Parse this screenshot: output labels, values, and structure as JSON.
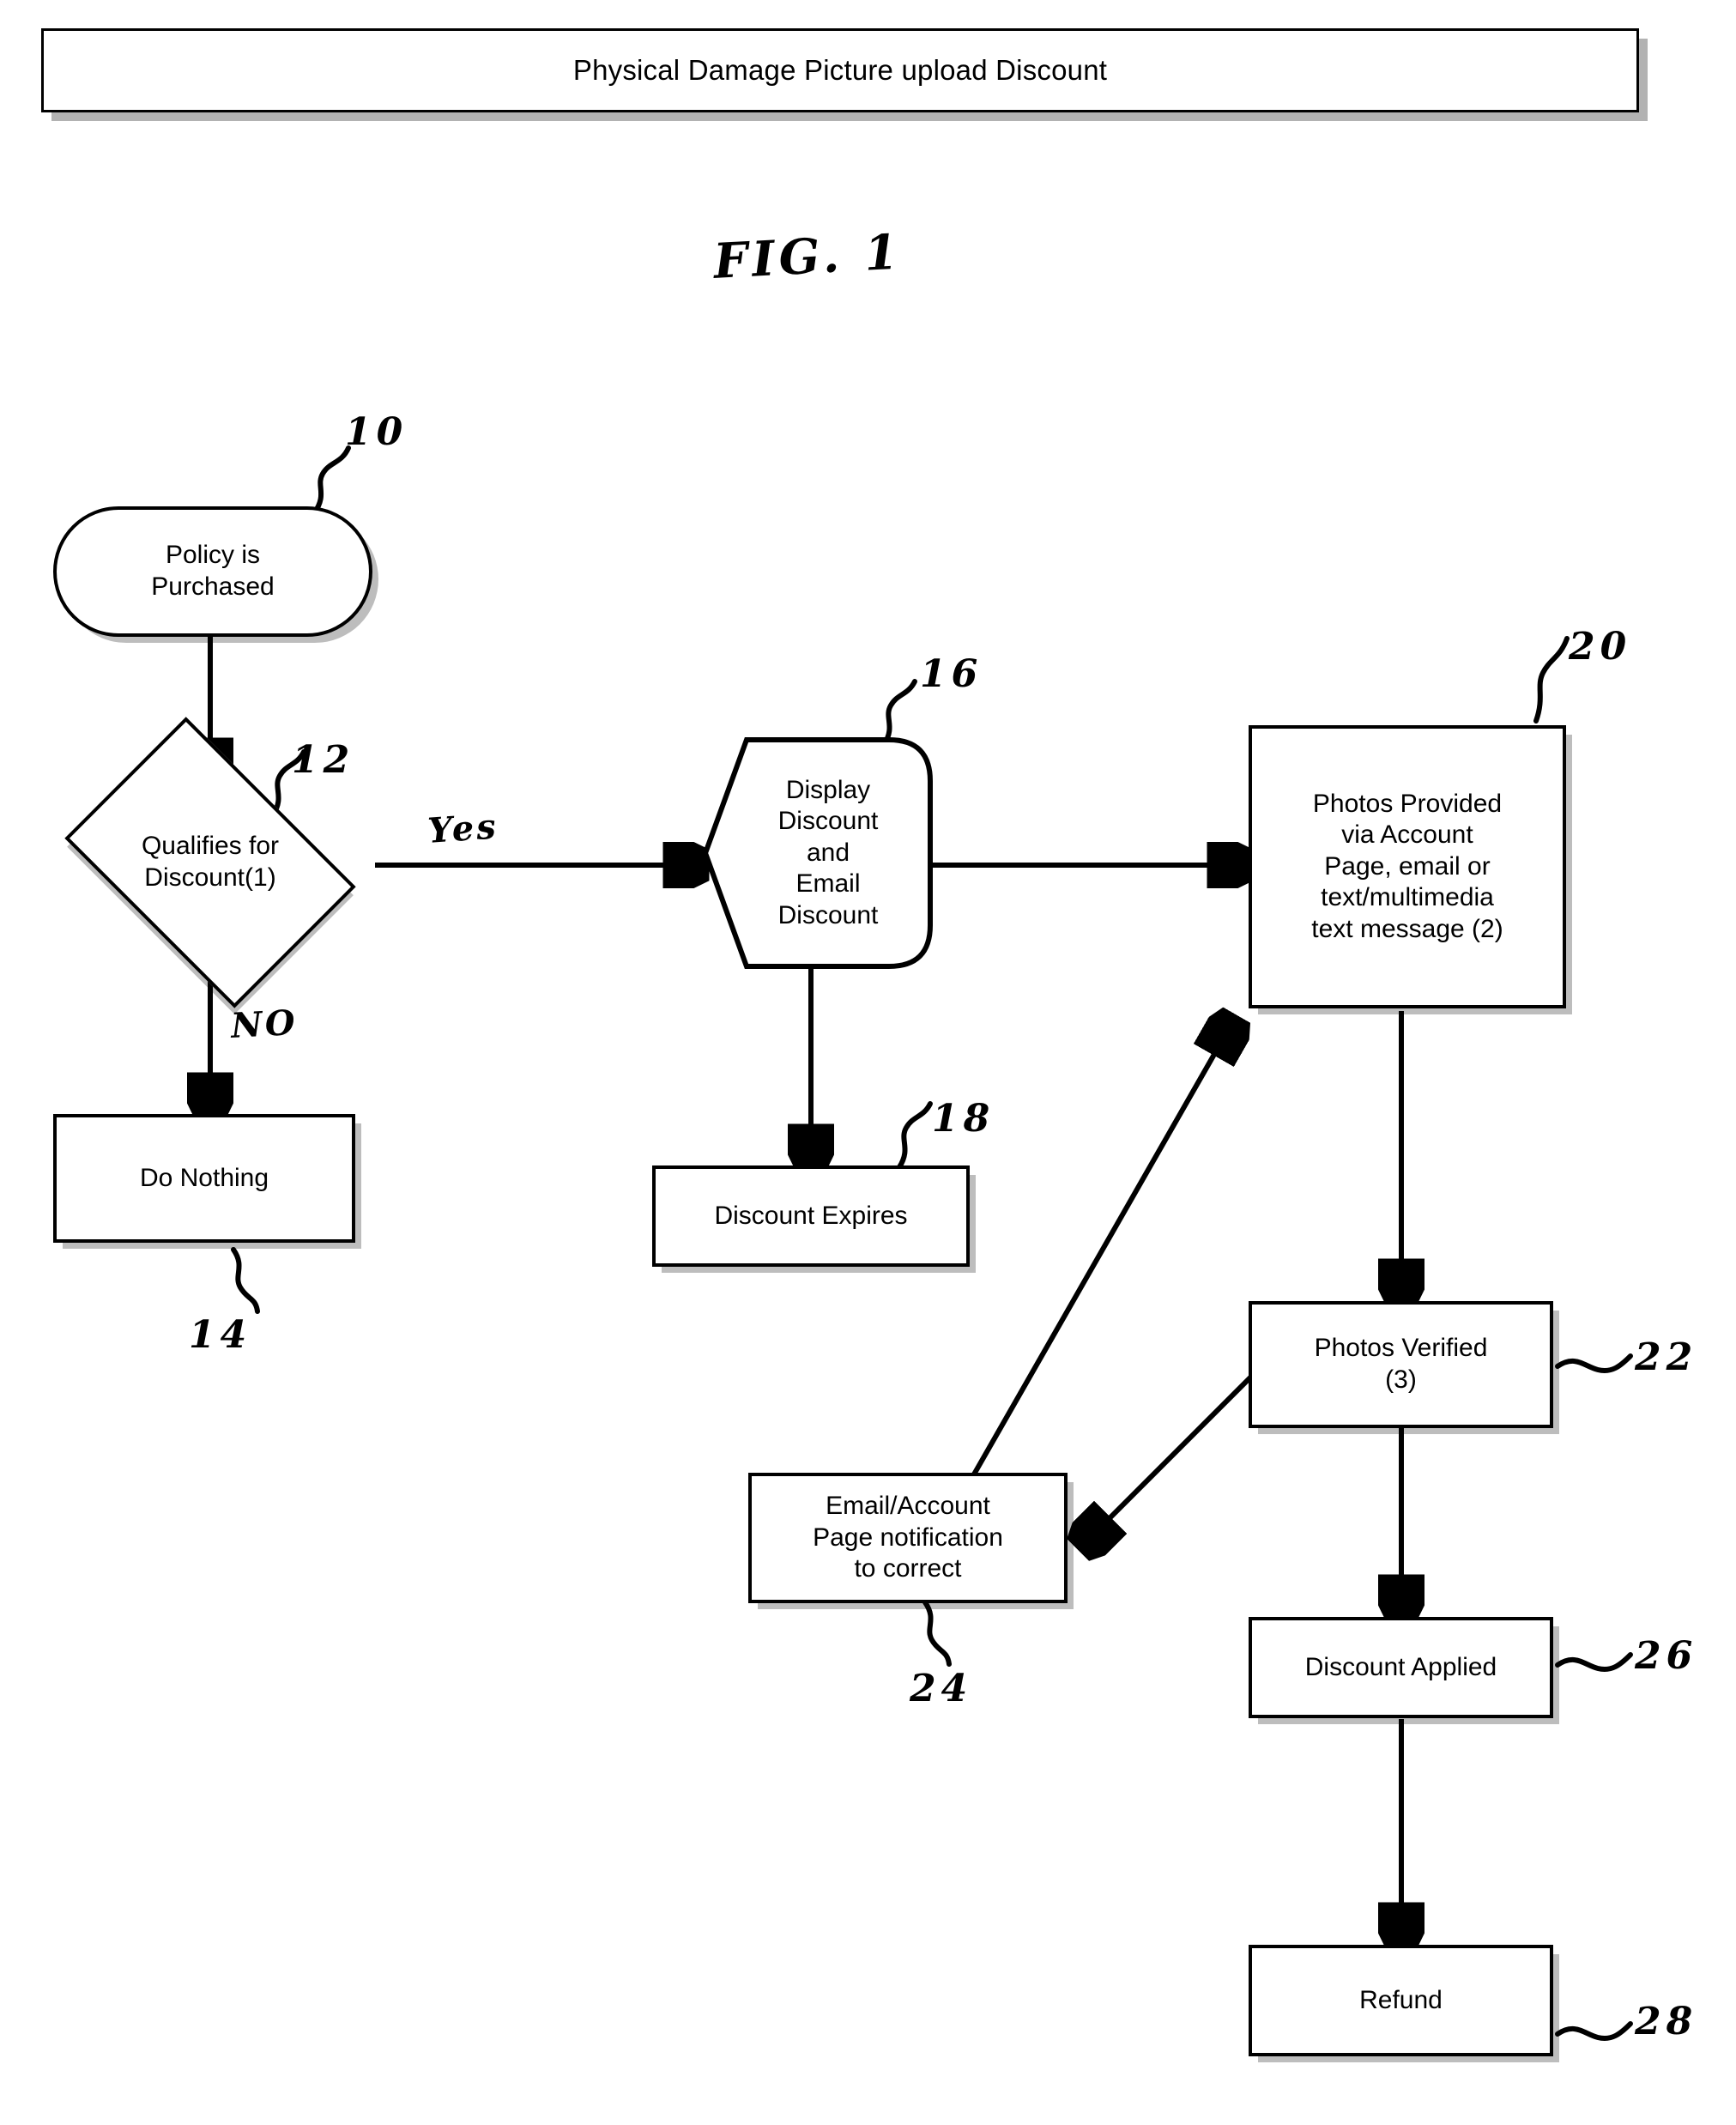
{
  "header": {
    "title": "Physical Damage Picture upload Discount"
  },
  "figure": {
    "label": "FIG. 1"
  },
  "chart_data": {
    "type": "diagram",
    "title": "Physical Damage Picture upload Discount",
    "figure_label": "FIG. 1",
    "nodes": [
      {
        "ref": "10",
        "shape": "stadium",
        "label": "Policy is\nPurchased"
      },
      {
        "ref": "12",
        "shape": "diamond",
        "label": "Qualifies for\nDiscount(1)"
      },
      {
        "ref": "14",
        "shape": "rectangle",
        "label": "Do Nothing"
      },
      {
        "ref": "16",
        "shape": "hexagon",
        "label": "Display\nDiscount\nand\nEmail\nDiscount"
      },
      {
        "ref": "18",
        "shape": "rectangle",
        "label": "Discount Expires"
      },
      {
        "ref": "20",
        "shape": "rectangle",
        "label": "Photos Provided\nvia Account\nPage, email or\ntext/multimedia\ntext message (2)"
      },
      {
        "ref": "22",
        "shape": "rectangle",
        "label": "Photos Verified\n(3)"
      },
      {
        "ref": "24",
        "shape": "rectangle",
        "label": "Email/Account\nPage notification\nto correct"
      },
      {
        "ref": "26",
        "shape": "rectangle",
        "label": "Discount Applied"
      },
      {
        "ref": "28",
        "shape": "rectangle",
        "label": "Refund"
      }
    ],
    "edges": [
      {
        "from": "10",
        "to": "12",
        "label": ""
      },
      {
        "from": "12",
        "to": "16",
        "label": "Yes"
      },
      {
        "from": "12",
        "to": "14",
        "label": "NO"
      },
      {
        "from": "16",
        "to": "20",
        "label": ""
      },
      {
        "from": "16",
        "to": "18",
        "label": ""
      },
      {
        "from": "20",
        "to": "22",
        "label": ""
      },
      {
        "from": "22",
        "to": "24",
        "label": ""
      },
      {
        "from": "24",
        "to": "20",
        "label": ""
      },
      {
        "from": "22",
        "to": "26",
        "label": ""
      },
      {
        "from": "26",
        "to": "28",
        "label": ""
      }
    ]
  },
  "nodes": {
    "policy_purchased": {
      "line1": "Policy is",
      "line2": "Purchased",
      "ref": "10"
    },
    "qualifies": {
      "line1": "Qualifies for",
      "line2": "Discount(1)",
      "ref": "12"
    },
    "do_nothing": {
      "label": "Do Nothing",
      "ref": "14"
    },
    "display_discount": {
      "line1": "Display",
      "line2": "Discount",
      "line3": "and",
      "line4": "Email",
      "line5": "Discount",
      "ref": "16"
    },
    "discount_expires": {
      "label": "Discount Expires",
      "ref": "18"
    },
    "photos_provided": {
      "line1": "Photos Provided",
      "line2": "via Account",
      "line3": "Page, email or",
      "line4": "text/multimedia",
      "line5": "text message (2)",
      "ref": "20"
    },
    "photos_verified": {
      "line1": "Photos Verified",
      "line2": "(3)",
      "ref": "22"
    },
    "email_notification": {
      "line1": "Email/Account",
      "line2": "Page notification",
      "line3": "to correct",
      "ref": "24"
    },
    "discount_applied": {
      "label": "Discount Applied",
      "ref": "26"
    },
    "refund": {
      "label": "Refund",
      "ref": "28"
    }
  },
  "edge_labels": {
    "yes": "Yes",
    "no": "NO"
  },
  "colors": {
    "ink": "#000000",
    "paper": "#ffffff",
    "shadow": "rgba(0,0,0,0.28)"
  }
}
